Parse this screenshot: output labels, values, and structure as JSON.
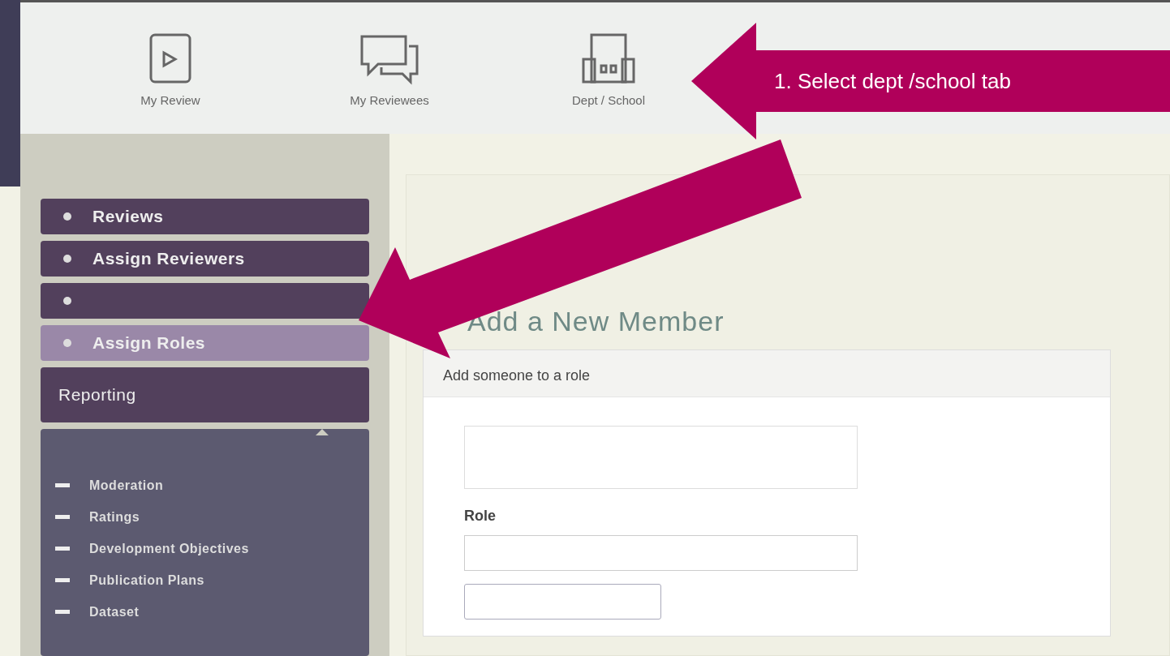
{
  "top_tabs": [
    {
      "label": "My Review",
      "selected": false
    },
    {
      "label": "My Reviewees",
      "selected": false
    },
    {
      "label": "Dept / School",
      "selected": false
    }
  ],
  "callouts": [
    {
      "label": "1. Select dept /school tab"
    }
  ],
  "sidebar": {
    "items": [
      {
        "label": "Reviews",
        "selected": false
      },
      {
        "label": "Assign Reviewers",
        "selected": false
      },
      {
        "selected": false
      },
      {
        "label": "Assign Roles",
        "selected": true
      }
    ],
    "section": {
      "title": "Reporting",
      "expanded": true,
      "children": [
        {
          "label": "Moderation"
        },
        {
          "label": "Ratings"
        },
        {
          "label": "Development Objectives"
        },
        {
          "label": "Publication Plans"
        },
        {
          "label": "Dataset"
        }
      ]
    }
  },
  "main": {
    "heading": "Add a New Member",
    "card": {
      "header": "Add someone to a role",
      "role_label": "Role"
    }
  }
}
